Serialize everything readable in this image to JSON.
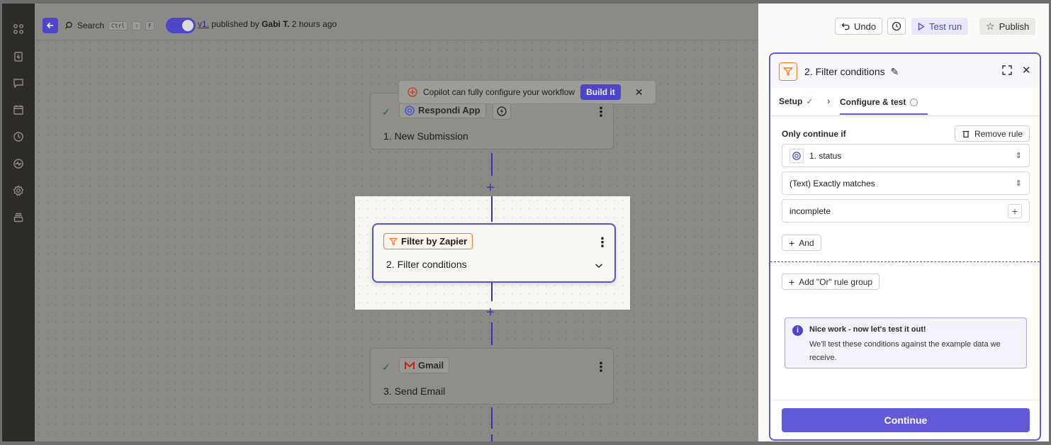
{
  "topbar": {
    "search_label": "Search",
    "shortcut_keys": [
      "Ctrl",
      "⇧",
      "F"
    ],
    "version_link": "v1.",
    "published_prefix": "published by",
    "author": "Gabi T.",
    "published_time": "2 hours ago"
  },
  "toolbar": {
    "undo_label": "Undo",
    "test_run_label": "Test run",
    "publish_label": "Publish"
  },
  "copilot_banner": {
    "text": "Copilot can fully configure your workflow",
    "build_label": "Build it"
  },
  "steps": [
    {
      "app": "Respondi App",
      "title": "1. New Submission",
      "status": "complete"
    },
    {
      "app": "Filter by Zapier",
      "title": "2. Filter conditions",
      "status": "selected"
    },
    {
      "app": "Gmail",
      "title": "3. Send Email",
      "status": "complete"
    }
  ],
  "panel": {
    "title": "2. Filter conditions",
    "tabs": [
      {
        "label": "Setup",
        "state": "complete"
      },
      {
        "label": "Configure & test",
        "state": "active"
      }
    ],
    "only_continue_label": "Only continue if",
    "remove_rule_label": "Remove rule",
    "rule": {
      "field": "1. status",
      "operator": "(Text) Exactly matches",
      "value": "incomplete"
    },
    "and_label": "And",
    "or_group_label": "Add \"Or\" rule group",
    "info": {
      "title": "Nice work - now let's test it out!",
      "body": "We'll test these conditions against the example data we receive."
    },
    "continue_label": "Continue"
  },
  "colors": {
    "accent": "#6259d9",
    "filter_orange": "#f47a34",
    "success_green": "#2e8b57"
  }
}
